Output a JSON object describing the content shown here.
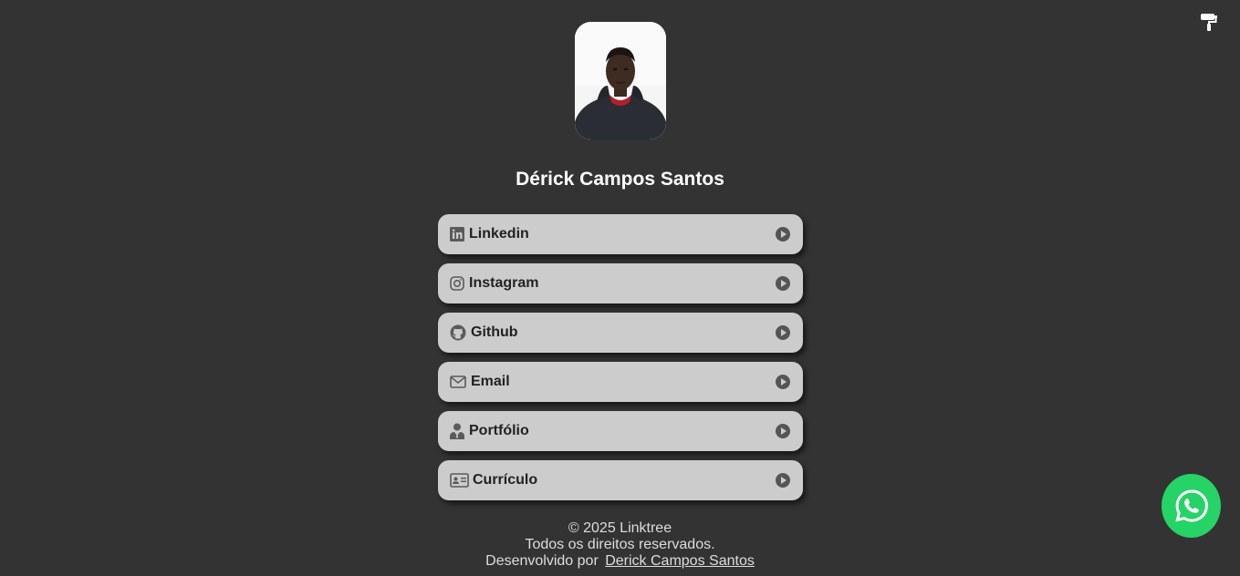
{
  "profile": {
    "name": "Dérick Campos Santos",
    "photo_alt": "Foto de perfil"
  },
  "links": [
    {
      "label": "Linkedin",
      "icon": "linkedin-icon"
    },
    {
      "label": "Instagram",
      "icon": "instagram-icon"
    },
    {
      "label": "Github",
      "icon": "github-icon"
    },
    {
      "label": "Email",
      "icon": "envelope-icon"
    },
    {
      "label": "Portfólio",
      "icon": "person-icon"
    },
    {
      "label": "Currículo",
      "icon": "id-card-icon"
    }
  ],
  "footer": {
    "copyright": "© 2025 Linktree",
    "rights": "Todos os direitos reservados.",
    "developed_by": "Desenvolvido por",
    "author_link": "Derick Campos Santos"
  },
  "colors": {
    "background": "#333333",
    "button": "#cccccc",
    "whatsapp": "#25d366"
  },
  "icons": {
    "theme_toggle": "paint-roller-icon",
    "arrow": "play-circle-icon",
    "whatsapp": "whatsapp-icon"
  }
}
